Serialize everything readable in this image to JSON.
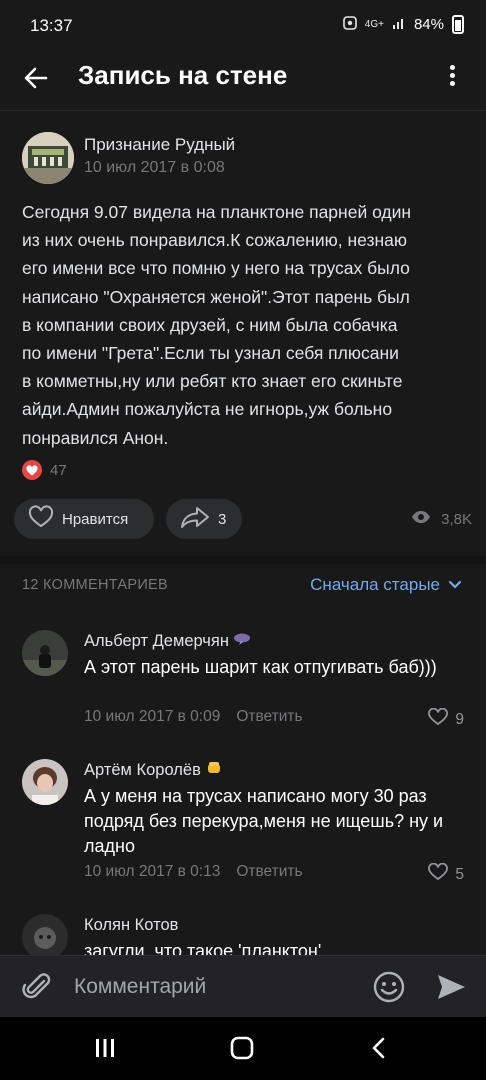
{
  "status_bar": {
    "time": "13:37",
    "battery": "84%",
    "network": "4G+"
  },
  "header": {
    "title": "Запись на стене"
  },
  "post": {
    "author": "Признание Рудный",
    "date": "10 июл 2017 в 0:08",
    "text": "Сегодня 9.07 видела на планктоне парней один\nиз них очень понравился.К сожалению, незнаю\nего имени все что помню у него на трусах было\nнаписано \"Охраняется женой\".Этот парень был\nв компании своих друзей, с ним была собачка\nпо имени \"Грета\".Если ты узнал себя плюсани\nв комметны,ну или ребят кто знает его скиньте\nайди.Админ пожалуйста не игнорь,уж больно\nпонравился Анон.",
    "reaction_count": "47",
    "like_label": "Нравится",
    "share_count": "3",
    "views": "3,8K"
  },
  "comments_section": {
    "count_label": "12 КОММЕНТАРИЕВ",
    "sort_label": "Сначала старые",
    "reply_label": "Ответить",
    "items": [
      {
        "author": "Альберт Демерчян",
        "text": "А этот парень шарит как отпугивать баб)))",
        "date": "10 июл 2017 в 0:09",
        "likes": "9"
      },
      {
        "author": "Артём Королёв",
        "text": "А у меня на трусах написано могу 30 раз подряд без перекура,меня не ищешь? ну и ладно",
        "date": "10 июл 2017 в 0:13",
        "likes": "5"
      },
      {
        "author": "Колян Котов",
        "text": "загугли, что такое 'планктон'"
      }
    ]
  },
  "composer": {
    "placeholder": "Комментарий"
  },
  "colors": {
    "background": "#19191a",
    "accent": "#71aaeb",
    "heart": "#e64646",
    "muted": "#76787a"
  }
}
